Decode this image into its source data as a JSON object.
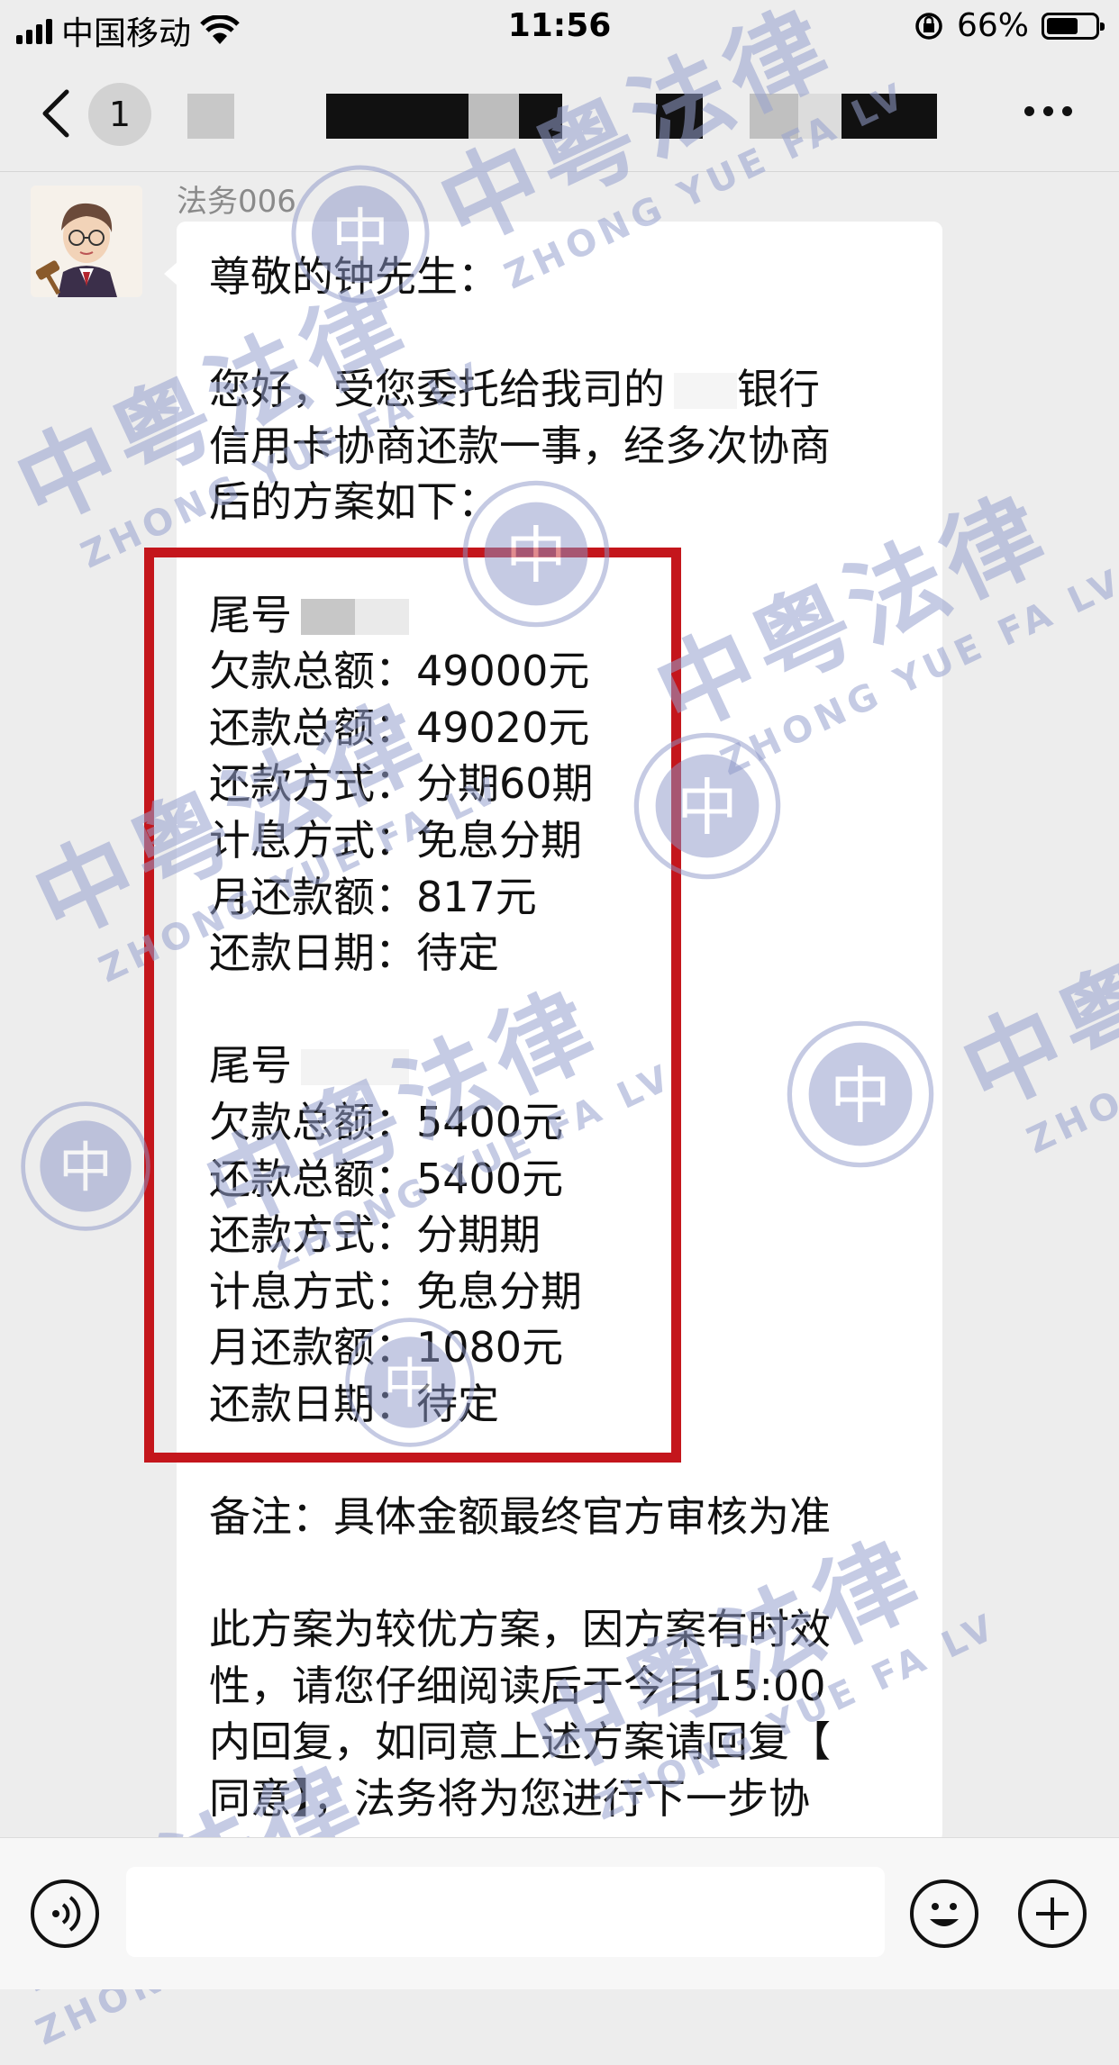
{
  "status_bar": {
    "carrier": "中国移动",
    "time": "11:56",
    "battery_percent_text": "66%",
    "battery_level": 0.66
  },
  "nav": {
    "unread_count": "1"
  },
  "message": {
    "sender": "法务006",
    "greeting": "尊敬的钟先生：",
    "intro_lines": [
      "您好，受您委托给我司的",
      "银行",
      "信用卡协商还款一事，经多次协商",
      "后的方案如下："
    ],
    "plans": [
      {
        "tail_label": "尾号",
        "rows": [
          "欠款总额：49000元",
          "还款总额：49020元",
          "还款方式：分期60期",
          "计息方式：免息分期",
          "月还款额：817元",
          "还款日期：待定"
        ]
      },
      {
        "tail_label": "尾号",
        "rows": [
          "欠款总额：5400元",
          "还款总额：5400元",
          "还款方式：分期期",
          "计息方式：免息分期",
          "月还款额：1080元",
          "还款日期：待定"
        ]
      }
    ],
    "note": "备注：具体金额最终官方审核为准",
    "closing_lines": [
      "此方案为较优方案，因方案有时效",
      "性，请您仔细阅读后于今日15:00",
      "内回复，如同意上述方案请回复【",
      "同意】，法务将为您进行下一步协"
    ]
  },
  "watermark": {
    "cn": "中粤法律",
    "en": "ZHONG YUE FA LV",
    "seal_char": "中"
  },
  "colors": {
    "background": "#ededed",
    "bubble": "#ffffff",
    "highlight_border": "#c4161c",
    "watermark": "#96a0cd"
  }
}
